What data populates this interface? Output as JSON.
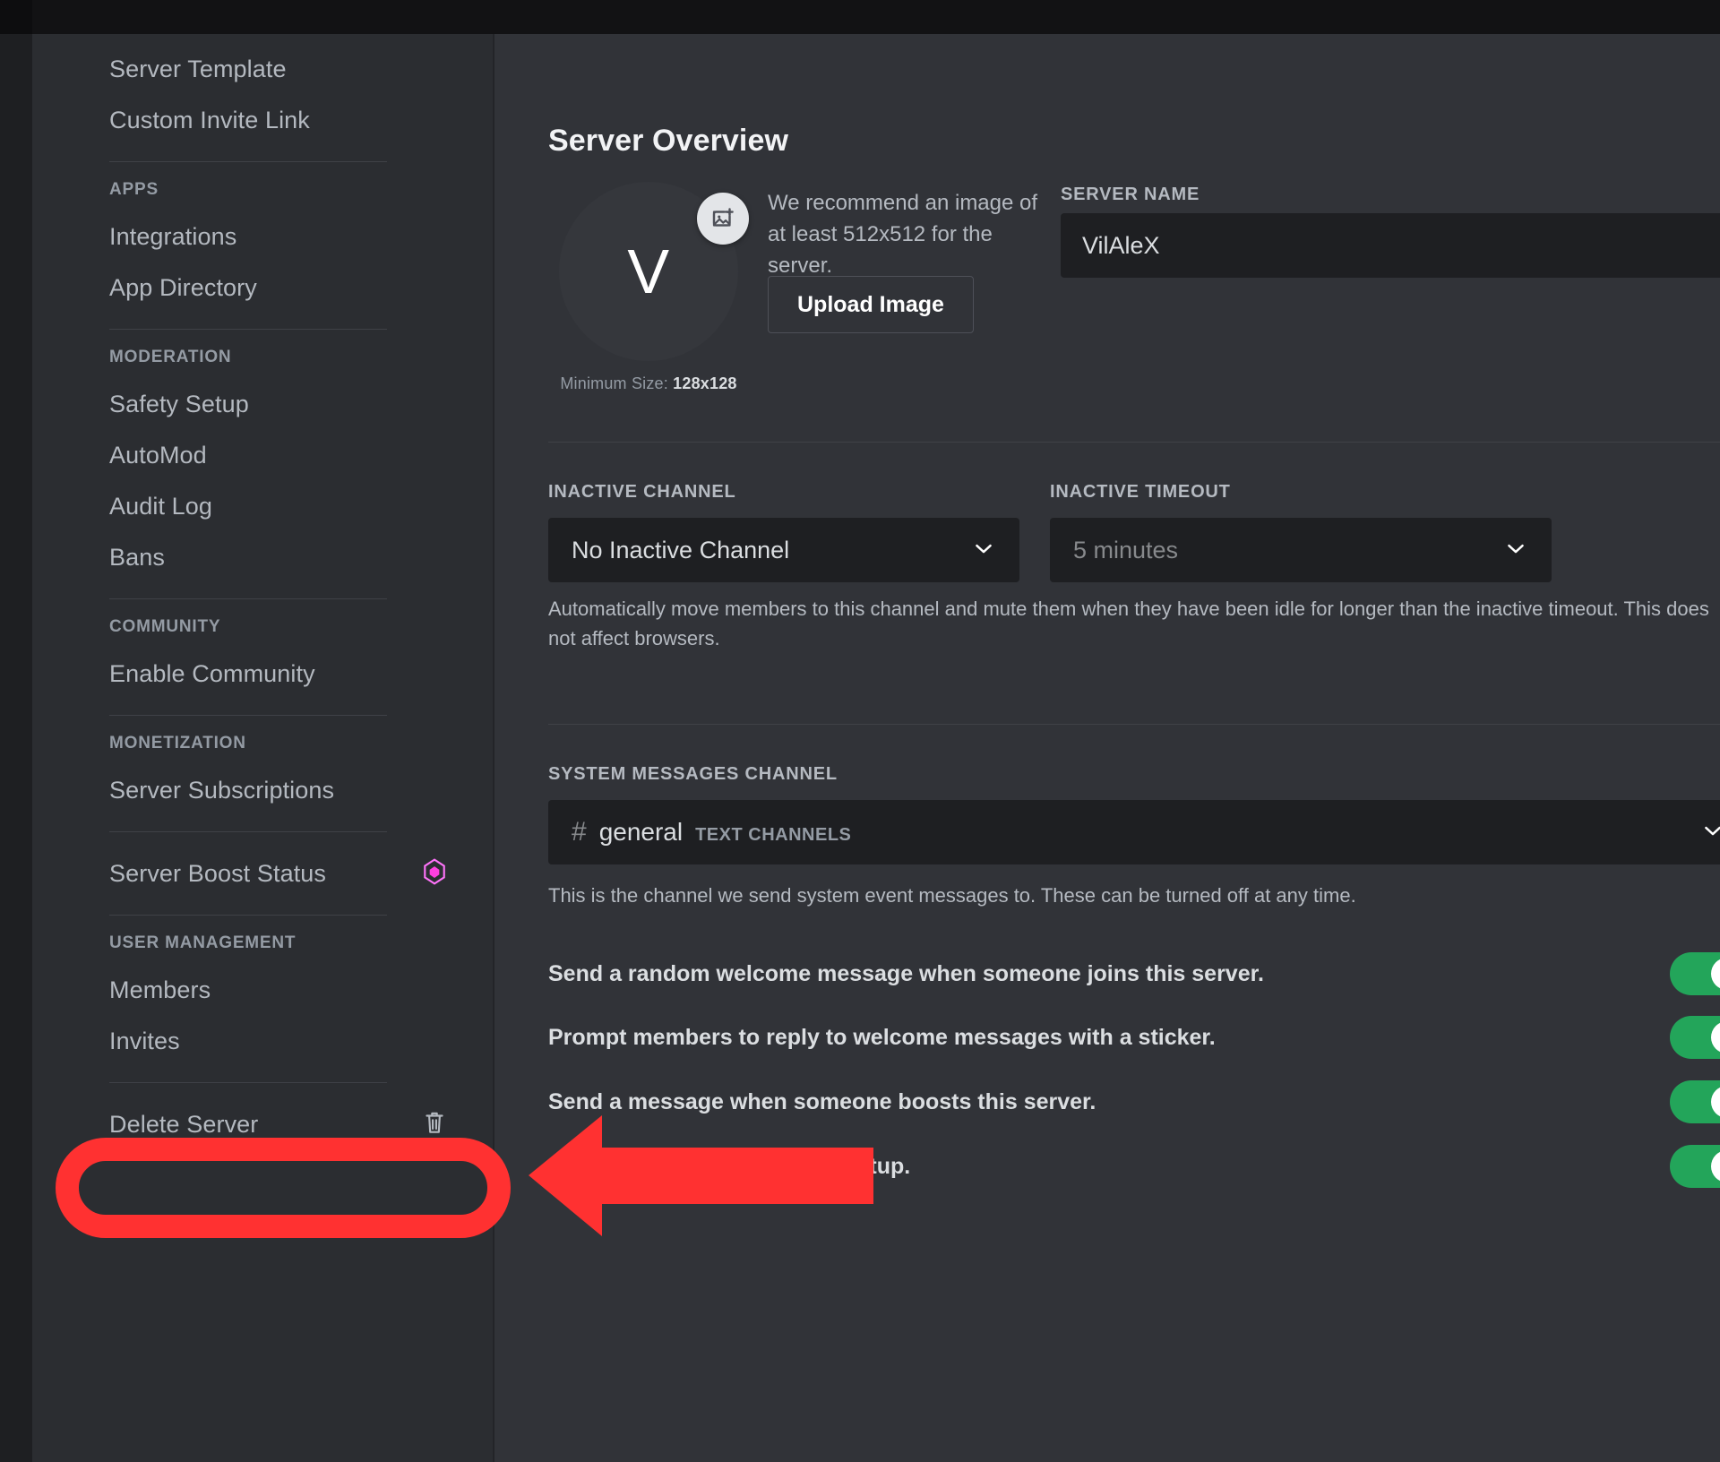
{
  "sidebar": {
    "groups": [
      {
        "title": null,
        "items": [
          {
            "label": "Server Template",
            "icon": null
          },
          {
            "label": "Custom Invite Link",
            "icon": null
          }
        ]
      },
      {
        "title": "APPS",
        "items": [
          {
            "label": "Integrations",
            "icon": null
          },
          {
            "label": "App Directory",
            "icon": null
          }
        ]
      },
      {
        "title": "MODERATION",
        "items": [
          {
            "label": "Safety Setup",
            "icon": null
          },
          {
            "label": "AutoMod",
            "icon": null
          },
          {
            "label": "Audit Log",
            "icon": null
          },
          {
            "label": "Bans",
            "icon": null
          }
        ]
      },
      {
        "title": "COMMUNITY",
        "items": [
          {
            "label": "Enable Community",
            "icon": null
          }
        ]
      },
      {
        "title": "MONETIZATION",
        "items": [
          {
            "label": "Server Subscriptions",
            "icon": null
          }
        ]
      },
      {
        "title": null,
        "items": [
          {
            "label": "Server Boost Status",
            "icon": "boost-icon"
          }
        ]
      },
      {
        "title": "USER MANAGEMENT",
        "items": [
          {
            "label": "Members",
            "icon": null
          },
          {
            "label": "Invites",
            "icon": null
          }
        ]
      },
      {
        "title": null,
        "items": [
          {
            "label": "Delete Server",
            "icon": "trash-icon"
          }
        ]
      }
    ]
  },
  "main": {
    "page_title": "Server Overview",
    "avatar": {
      "initial": "V",
      "badge_icon": "add-image-icon",
      "min_size_prefix": "Minimum Size: ",
      "min_size_value": "128x128"
    },
    "recommend_text": "We recommend an image of at least 512x512 for the server.",
    "upload_button": "Upload Image",
    "server_name": {
      "label": "SERVER NAME",
      "value": "VilAleX"
    },
    "inactive_channel": {
      "label": "INACTIVE CHANNEL",
      "value": "No Inactive Channel",
      "chevron_icon": "chevron-down-icon"
    },
    "inactive_timeout": {
      "label": "INACTIVE TIMEOUT",
      "value": "5 minutes",
      "chevron_icon": "chevron-down-icon"
    },
    "inactive_help": "Automatically move members to this channel and mute them when they have been idle for longer than the inactive timeout. This does not affect browsers.",
    "system_messages": {
      "label": "SYSTEM MESSAGES CHANNEL",
      "hash": "#",
      "channel": "general",
      "category": "TEXT CHANNELS",
      "chevron_icon": "chevron-down-icon",
      "help": "This is the channel we send system event messages to. These can be turned off at any time."
    },
    "toggles": [
      {
        "label": "Send a random welcome message when someone joins this server.",
        "on": true
      },
      {
        "label": "Prompt members to reply to welcome messages with a sticker.",
        "on": true
      },
      {
        "label": "Send a message when someone boosts this server.",
        "on": true
      },
      {
        "label": "Send helpful tips for server setup.",
        "on": true
      }
    ]
  },
  "annotation": {
    "color": "#FF3131",
    "highlight_target": "Members",
    "shapes": [
      "rounded-rect-highlight",
      "left-arrow"
    ]
  },
  "colors": {
    "accent_green": "#23a55a",
    "boost_pink": "#ff73fa",
    "annotation_red": "#FF3131",
    "sidebar_bg": "#2b2d31",
    "content_bg": "#313338",
    "input_bg": "#1e1f22"
  }
}
